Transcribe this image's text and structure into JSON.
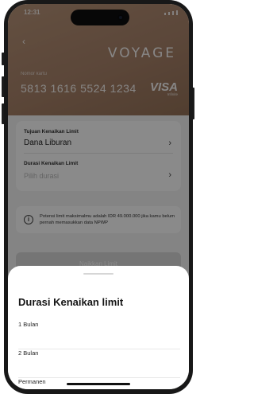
{
  "status_bar": {
    "time": "12:31"
  },
  "header": {
    "back_icon": "chevron-left-icon",
    "brand": "VOYAGE"
  },
  "card": {
    "label": "Nomor kartu",
    "number": "5813 1616 5524 1234",
    "network": "VISA",
    "network_sub": "Infinite"
  },
  "form": {
    "purpose_label": "Tujuan Kenaikan Limit",
    "purpose_value": "Dana Liburan",
    "duration_label": "Durasi Kenaikan Limit",
    "duration_placeholder": "Pilih durasi"
  },
  "info": {
    "icon": "info-icon",
    "text": "Potensi limit maksimalmu adalah IDR 49.000.000 jika kamu belum pernah memasukkan data NPWP"
  },
  "submit": {
    "label": "Naikkan Limit"
  },
  "sheet": {
    "title": "Durasi Kenaikan limit",
    "options": [
      {
        "label": "1 Bulan"
      },
      {
        "label": "2 Bulan"
      },
      {
        "label": "Permanen"
      }
    ]
  },
  "colors": {
    "hero": "#a9836a",
    "overlay": "rgba(0,0,0,0.46)",
    "sheet_bg": "#ffffff",
    "button_disabled": "#d8d8d8"
  }
}
